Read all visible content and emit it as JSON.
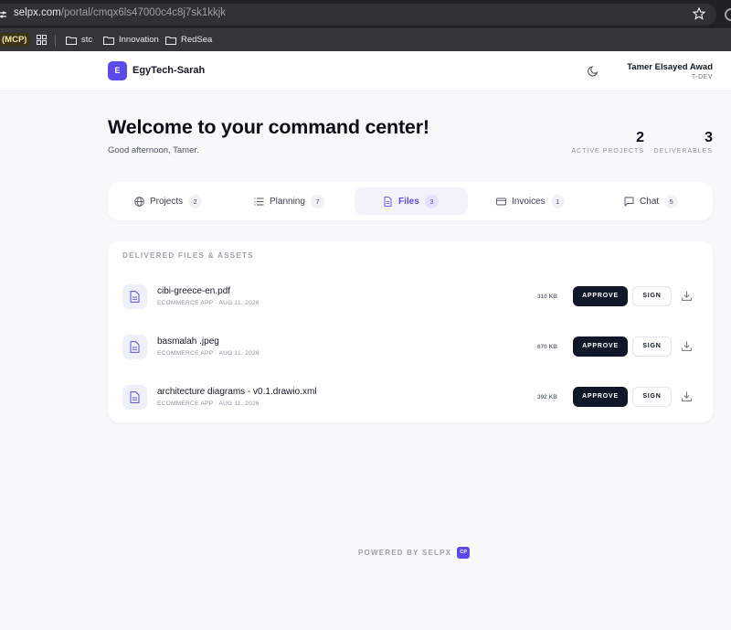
{
  "browser": {
    "url_host": "selpx.com",
    "url_path": "/portal/cmqx6ls47000c4c8j7sk1kkjk",
    "bookmarks": [
      "(MCP)",
      "stc",
      "Innovation",
      "RedSea"
    ]
  },
  "header": {
    "logo_letter": "E",
    "brand": "EgyTech-Sarah",
    "user_name": "Tamer Elsayed Awad",
    "user_role": "T-DEV"
  },
  "welcome": {
    "title": "Welcome to your command center!",
    "greeting": "Good afternoon, Tamer."
  },
  "stats": [
    {
      "value": "2",
      "label": "ACTIVE PROJECTS"
    },
    {
      "value": "3",
      "label": "DELIVERABLES"
    }
  ],
  "tabs": [
    {
      "label": "Projects",
      "count": "2",
      "icon": "globe-icon"
    },
    {
      "label": "Planning",
      "count": "7",
      "icon": "list-icon"
    },
    {
      "label": "Files",
      "count": "3",
      "icon": "document-icon",
      "active": true
    },
    {
      "label": "Invoices",
      "count": "1",
      "icon": "card-icon"
    },
    {
      "label": "Chat",
      "count": "5",
      "icon": "chat-icon"
    }
  ],
  "files": {
    "section_title": "DELIVERED FILES & ASSETS",
    "approve_label": "APPROVE",
    "sign_label": "SIGN",
    "items": [
      {
        "name": "cibi-greece-en.pdf",
        "meta": "ECOMMERCE APP · AUG 11, 2026",
        "size": "310 KB"
      },
      {
        "name": "basmalah .jpeg",
        "meta": "ECOMMERCE APP · AUG 11, 2026",
        "size": "670 KB"
      },
      {
        "name": "architecture diagrams - v0.1.drawio.xml",
        "meta": "ECOMMERCE APP · AUG 11, 2026",
        "size": "392 KB"
      }
    ]
  },
  "footer": {
    "text": "POWERED BY SELPX",
    "badge": "CP"
  },
  "colors": {
    "accent": "#5b4ae6",
    "primary_button": "#0f1729",
    "background": "#f7f8fa"
  }
}
